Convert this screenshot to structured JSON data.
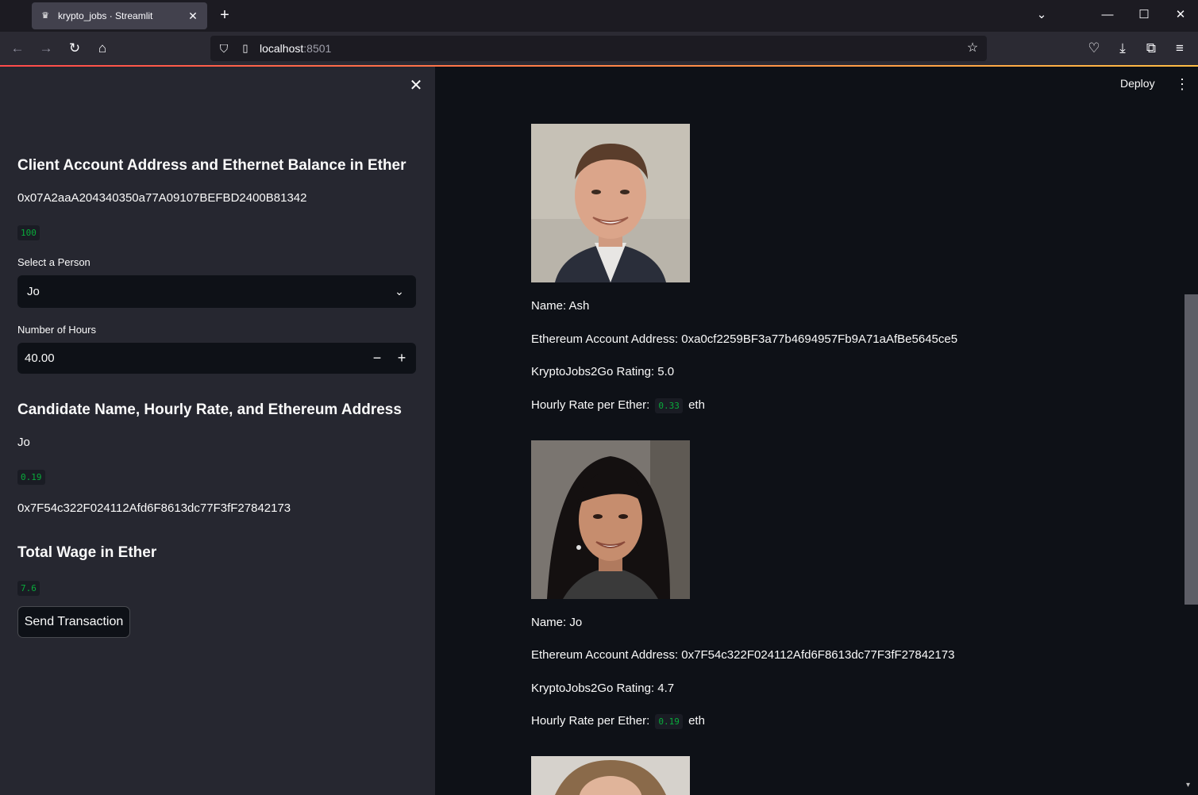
{
  "browser": {
    "tab_title": "krypto_jobs · Streamlit",
    "url_host": "localhost",
    "url_port": ":8501"
  },
  "header": {
    "deploy_label": "Deploy"
  },
  "sidebar": {
    "client_heading": "Client Account Address and Ethernet Balance in Ether",
    "client_address": "0x07A2aaA204340350a77A09107BEFBD2400B81342",
    "client_balance": "100",
    "select_label": "Select a Person",
    "select_value": "Jo",
    "hours_label": "Number of Hours",
    "hours_value": "40.00",
    "candidate_heading": "Candidate Name, Hourly Rate, and Ethereum Address",
    "candidate_name": "Jo",
    "candidate_rate": "0.19",
    "candidate_address": "0x7F54c322F024112Afd6F8613dc77F3fF27842173",
    "wage_heading": "Total Wage in Ether",
    "wage_value": "7.6",
    "send_label": "Send Transaction"
  },
  "candidates": [
    {
      "name_line": "Name: Ash",
      "address_line": "Ethereum Account Address: 0xa0cf2259BF3a77b4694957Fb9A71aAfBe5645ce5",
      "rating_line": "KryptoJobs2Go Rating: 5.0",
      "rate_prefix": "Hourly Rate per Ether:",
      "rate": "0.33",
      "rate_suffix": "eth"
    },
    {
      "name_line": "Name: Jo",
      "address_line": "Ethereum Account Address: 0x7F54c322F024112Afd6F8613dc77F3fF27842173",
      "rating_line": "KryptoJobs2Go Rating: 4.7",
      "rate_prefix": "Hourly Rate per Ether:",
      "rate": "0.19",
      "rate_suffix": "eth"
    }
  ]
}
